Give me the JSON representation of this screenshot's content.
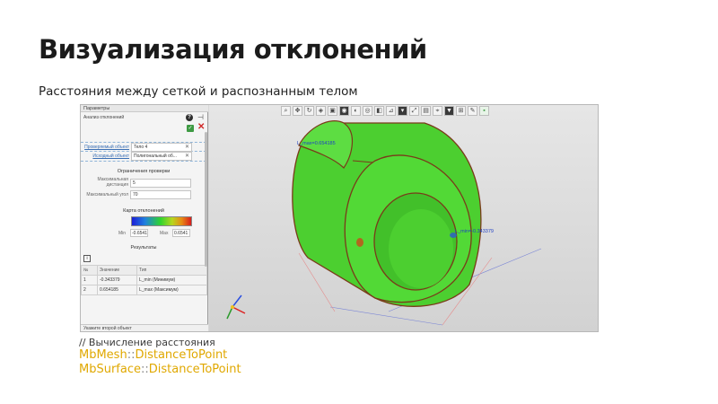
{
  "slide": {
    "title": "Визуализация отклонений",
    "subtitle": "Расстояния между сеткой и распознанным телом"
  },
  "panel": {
    "title": "Параметры",
    "subtitle": "Анализ отклонений",
    "first_object_label": "Проверяемый объект",
    "first_object_value": "Тело 4",
    "second_object_label": "Исходный объект",
    "second_object_value": "Полигональный об...",
    "limits_title": "Ограничения проверки",
    "max_distance_label": "Максимальная дистанция",
    "max_distance_value": "5",
    "max_angle_label": "Максимальный угол",
    "max_angle_value": "70",
    "colormap_title": "Карта отклонений",
    "min_label": "Min",
    "min_value": "-0.6541",
    "max_label": "Max",
    "max_value": "0.6541",
    "results_title": "Результаты",
    "status": "Укажите второй объект"
  },
  "table": {
    "headers": [
      "№",
      "Значение",
      "Тип"
    ],
    "rows": [
      [
        "1",
        "-0.343379",
        "L_min (Минимум)"
      ],
      [
        "2",
        "0.654185",
        "L_max (Максимум)"
      ]
    ]
  },
  "viewport": {
    "label_max": "L_max=0.654185",
    "label_min": "L_min=-0.343379"
  },
  "code": {
    "comment": "// Вычисление расстояния",
    "line1_class": "MbMesh",
    "line1_method": "DistanceToPoint",
    "line2_class": "MbSurface",
    "line2_method": "DistanceToPoint",
    "separator": "::"
  },
  "colors": {
    "body_green": "#4ccf30",
    "edge_dark": "#7a3a1a",
    "label_blue": "#1f3fc4",
    "code_yellow": "#e0a800"
  }
}
